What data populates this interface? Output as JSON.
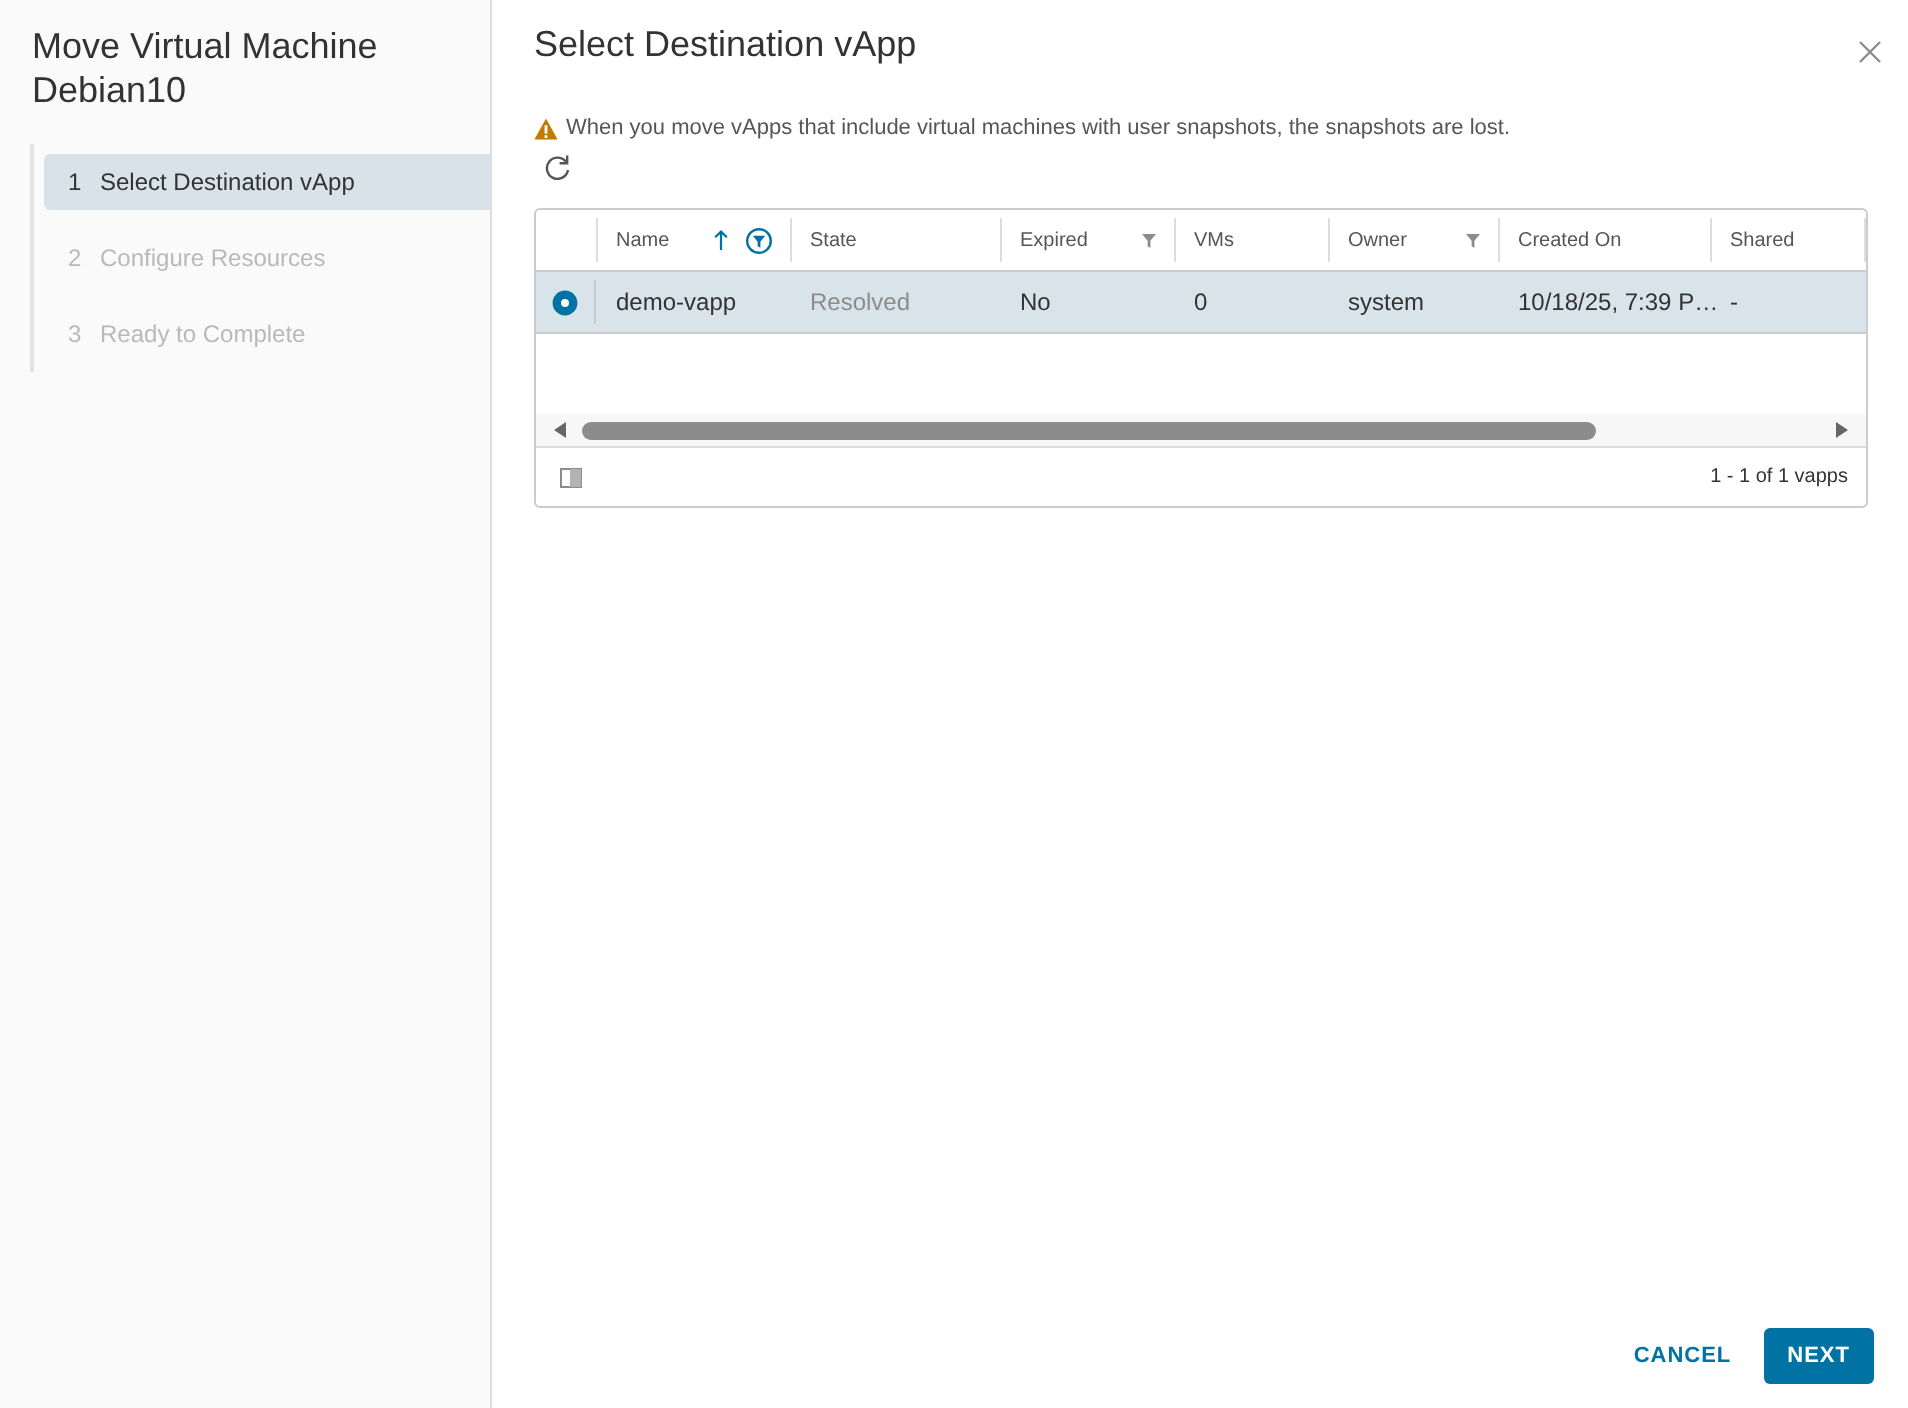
{
  "sidebar": {
    "title": "Move Virtual Machine Debian10",
    "steps": [
      {
        "number": "1",
        "label": "Select Destination vApp",
        "selected": true,
        "disabled": false
      },
      {
        "number": "2",
        "label": "Configure Resources",
        "selected": false,
        "disabled": true
      },
      {
        "number": "3",
        "label": "Ready to Complete",
        "selected": false,
        "disabled": true
      }
    ]
  },
  "page": {
    "title": "Select Destination vApp",
    "warning": "When you move vApps that include virtual machines with user snapshots, the snapshots are lost."
  },
  "table": {
    "columns": [
      {
        "label": "Name",
        "kind": "text",
        "sorted": true,
        "filter": true,
        "filter_active": true
      },
      {
        "label": "State",
        "kind": "status",
        "sorted": false,
        "filter": false
      },
      {
        "label": "Expired",
        "kind": "text",
        "sorted": false,
        "filter": true,
        "filter_active": false
      },
      {
        "label": "VMs",
        "kind": "text",
        "sorted": false,
        "filter": false
      },
      {
        "label": "Owner",
        "kind": "text",
        "sorted": false,
        "filter": true,
        "filter_active": false
      },
      {
        "label": "Created On",
        "kind": "text",
        "sorted": false,
        "filter": false
      },
      {
        "label": "Shared",
        "kind": "text",
        "sorted": false,
        "filter": false
      }
    ],
    "rows": [
      {
        "selected": true,
        "cells": [
          "demo-vapp",
          "Resolved",
          "No",
          "0",
          "system",
          "10/18/25, 7:39 P…",
          "-"
        ]
      }
    ],
    "footer": "1 - 1 of 1 vapps"
  },
  "buttons": [
    {
      "label": "CANCEL",
      "kind": "flat"
    },
    {
      "label": "NEXT",
      "kind": "primary"
    }
  ]
}
